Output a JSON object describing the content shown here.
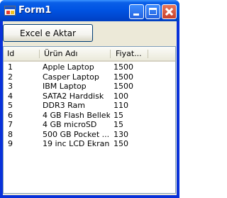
{
  "window": {
    "title": "Form1",
    "controls": {
      "minimize": "minimize",
      "maximize": "maximize",
      "close": "close"
    },
    "colors": {
      "titlebar": "#0054e3",
      "close_button": "#c8402a",
      "client_bg": "#ece9d8"
    }
  },
  "toolbar": {
    "export_label": "Excel e Aktar"
  },
  "list": {
    "columns": [
      "Id",
      "Ürün Adı",
      "Fiyat..."
    ],
    "rows": [
      [
        "1",
        "Apple Laptop",
        "1500"
      ],
      [
        "2",
        "Casper Laptop",
        "1500"
      ],
      [
        "3",
        "IBM Laptop",
        "1500"
      ],
      [
        "4",
        "SATA2 Harddisk",
        "100"
      ],
      [
        "5",
        "DDR3 Ram",
        "110"
      ],
      [
        "6",
        "4 GB Flash Bellek",
        "15"
      ],
      [
        "7",
        "4 GB microSD",
        "15"
      ],
      [
        "8",
        "500 GB Pocket ...",
        "130"
      ],
      [
        "9",
        "19 inc LCD Ekran",
        "150"
      ]
    ]
  }
}
